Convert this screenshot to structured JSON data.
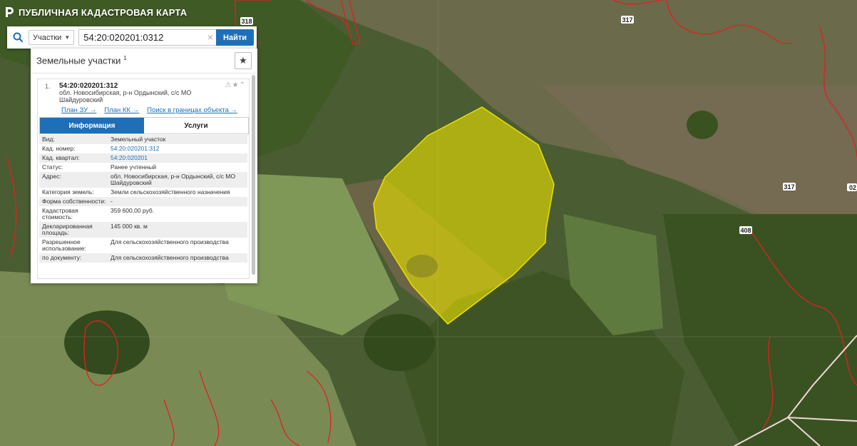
{
  "header": {
    "title": "ПУБЛИЧНАЯ КАДАСТРОВАЯ КАРТА",
    "icon": "pkk-logo-icon"
  },
  "search": {
    "type_label": "Участки",
    "query": "54:20:020201:0312",
    "find_label": "Найти"
  },
  "panel": {
    "title": "Земельные участки",
    "count": "1",
    "result": {
      "index": "1.",
      "cad_number": "54:20:020201:312",
      "address": "обл. Новосибирская, р-н Ордынский, с/с МО Шайдуровский",
      "links": [
        "План ЗУ →",
        "План КК →",
        "Поиск в границах объекта →"
      ],
      "tabs": [
        "Информация",
        "Услуги"
      ],
      "attributes": [
        {
          "key": "Вид:",
          "value": "Земельный участок",
          "link": false
        },
        {
          "key": "Кад. номер:",
          "value": "54:20:020201:312",
          "link": true
        },
        {
          "key": "Кад. квартал:",
          "value": "54:20:020201",
          "link": true
        },
        {
          "key": "Статус:",
          "value": "Ранее учтенный",
          "link": false
        },
        {
          "key": "Адрес:",
          "value": "обл. Новосибирская, р-н Ордынский, с/с МО Шайдуровский",
          "link": false
        },
        {
          "key": "Категория земель:",
          "value": "Земли сельскохозяйственного назначения",
          "link": false
        },
        {
          "key": "Форма собственности:",
          "value": "-",
          "link": false
        },
        {
          "key": "Кадастровая стоимость:",
          "value": "359 600,00 руб.",
          "link": false
        },
        {
          "key": "Декларированная площадь:",
          "value": "145 000 кв. м",
          "link": false
        },
        {
          "key": "Разрешенное использование:",
          "value": "Для сельскохозяйственного производства",
          "link": false
        },
        {
          "key": "по документу:",
          "value": "Для сельскохозяйственного производства",
          "link": false
        }
      ]
    }
  },
  "map": {
    "parcel_labels": [
      "318",
      "317",
      "317",
      "408",
      "02"
    ],
    "colors": {
      "parcel_highlight": "#e8e000",
      "boundary": "#e02020",
      "accent": "#1e6fb8"
    }
  }
}
